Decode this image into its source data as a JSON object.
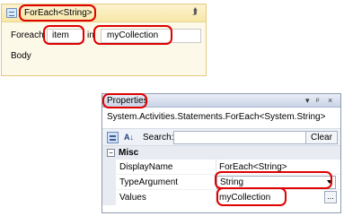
{
  "activity": {
    "title": "ForEach<String>",
    "foreach_label": "Foreach",
    "item_value": "item",
    "in_label": "in",
    "collection_value": "myCollection",
    "body_label": "Body",
    "collapse_icon": "double-chevron-up-icon"
  },
  "properties": {
    "title": "Properties",
    "titlebar_glyphs": [
      "▾",
      "ᵖ",
      "×"
    ],
    "type_name": "System.Activities.Statements.ForEach<System.String>",
    "search_label": "Search:",
    "search_value": "",
    "clear_label": "Clear",
    "category_toggle": "−",
    "category": "Misc",
    "alpha_sort_label": "A↓",
    "rows": [
      {
        "name": "DisplayName",
        "value": "ForEach<String>"
      },
      {
        "name": "TypeArgument",
        "value": "String"
      },
      {
        "name": "Values",
        "value": "myCollection"
      }
    ],
    "ellipsis_label": "..."
  },
  "annotation_color": "#e00000"
}
